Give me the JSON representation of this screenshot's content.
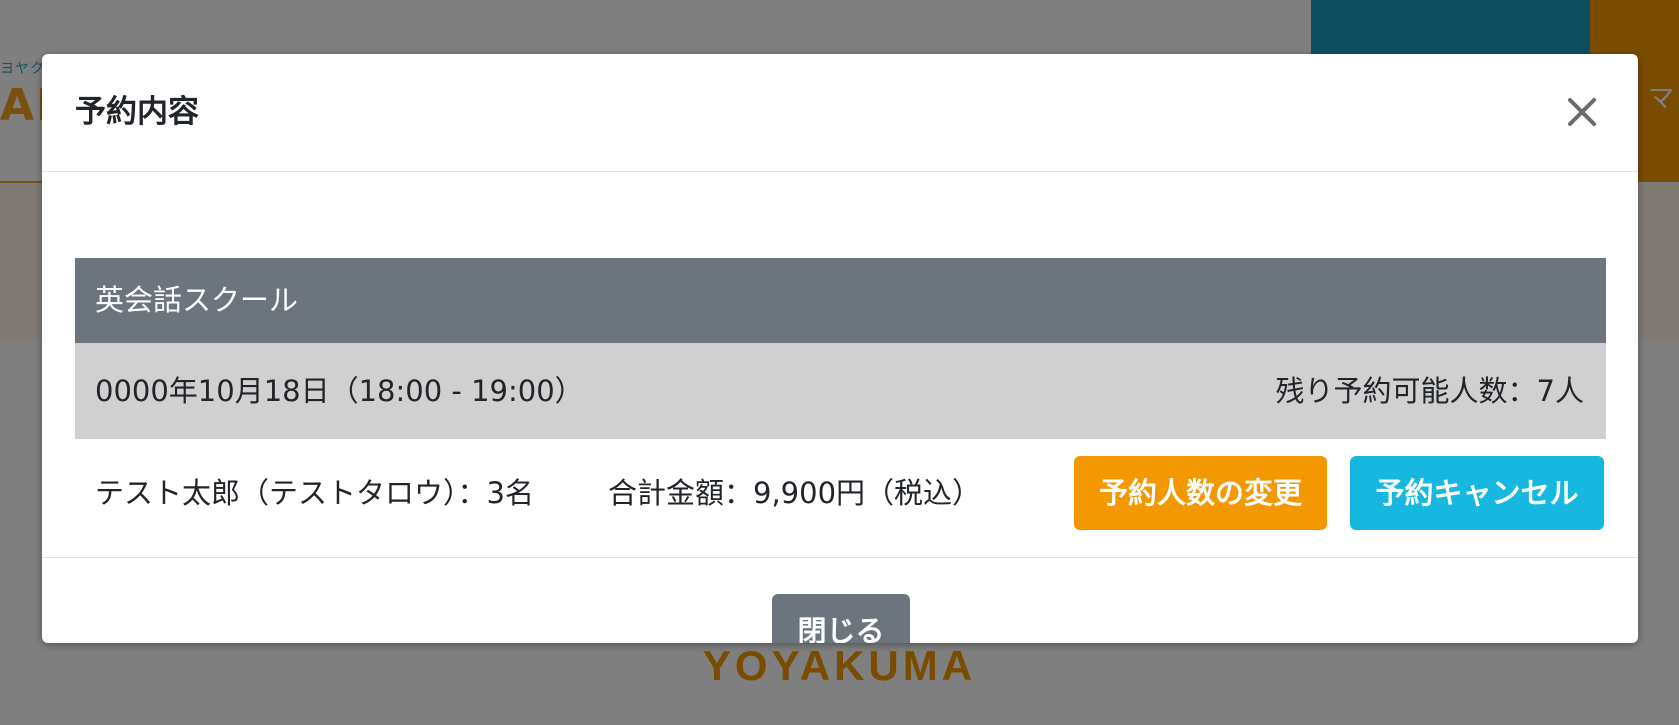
{
  "background": {
    "logo_small": "ヨヤク",
    "logo_big": "AK",
    "orange_block_text": "マ",
    "footer_logo": "YOYAKUMA"
  },
  "modal": {
    "title": "予約内容",
    "close_icon": "close-icon",
    "course_name": "英会話スクール",
    "date_time": "0000年10月18日（18:00 - 19:00）",
    "remaining": "残り予約可能人数：7人",
    "booker": "テスト太郎（テストタロウ）：3名",
    "total": "合計金額：9,900円（税込）",
    "change_button_label": "予約人数の変更",
    "cancel_button_label": "予約キャンセル",
    "close_button_label": "閉じる"
  },
  "colors": {
    "brand_orange": "#f39800",
    "brand_cyan": "#17b8e0",
    "secondary_gray": "#6c757d"
  }
}
